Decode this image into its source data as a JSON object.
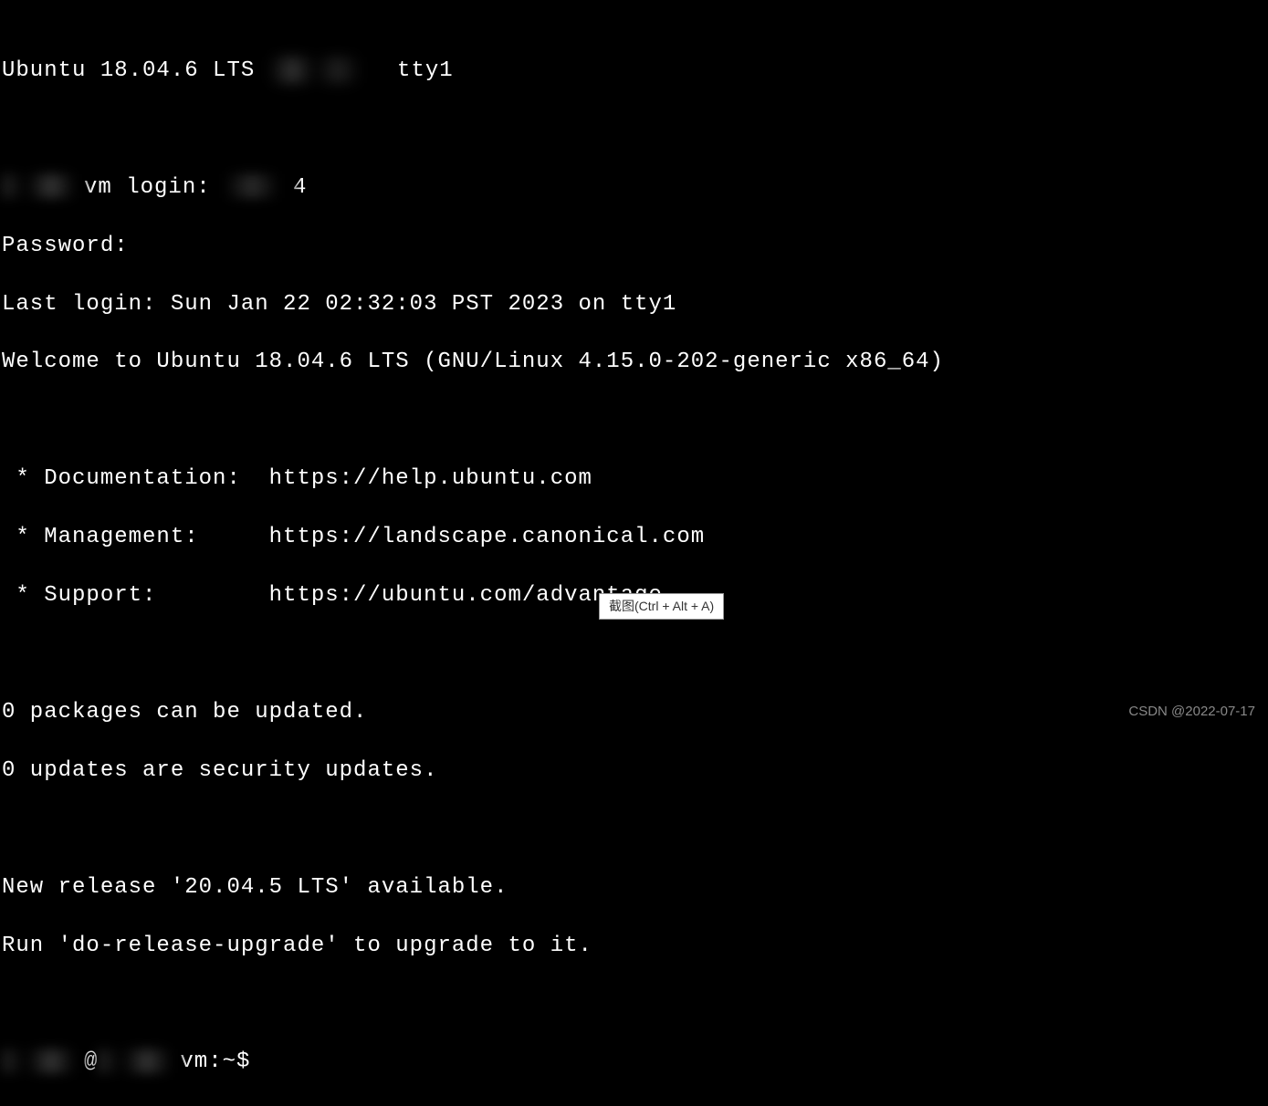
{
  "terminal": {
    "header_prefix": "Ubuntu 18.04.6 LTS",
    "header_suffix": " tty1",
    "login_prefix": "vm login: ",
    "login_suffix": "4",
    "password_label": "Password:",
    "last_login": "Last login: Sun Jan 22 02:32:03 PST 2023 on tty1",
    "welcome": "Welcome to Ubuntu 18.04.6 LTS (GNU/Linux 4.15.0-202-generic x86_64)",
    "documentation": " * Documentation:  https://help.ubuntu.com",
    "management": " * Management:     https://landscape.canonical.com",
    "support": " * Support:        https://ubuntu.com/advantage",
    "packages": "0 packages can be updated.",
    "security_updates": "0 updates are security updates.",
    "new_release": "New release '20.04.5 LTS' available.",
    "upgrade_hint": "Run 'do-release-upgrade' to upgrade to it.",
    "prompt_at": "@",
    "prompt_mid": "vm:~$",
    "prompt_cursor": " "
  },
  "tooltip": "截图(Ctrl + Alt + A)",
  "watermark": "CSDN @2022-07-17"
}
